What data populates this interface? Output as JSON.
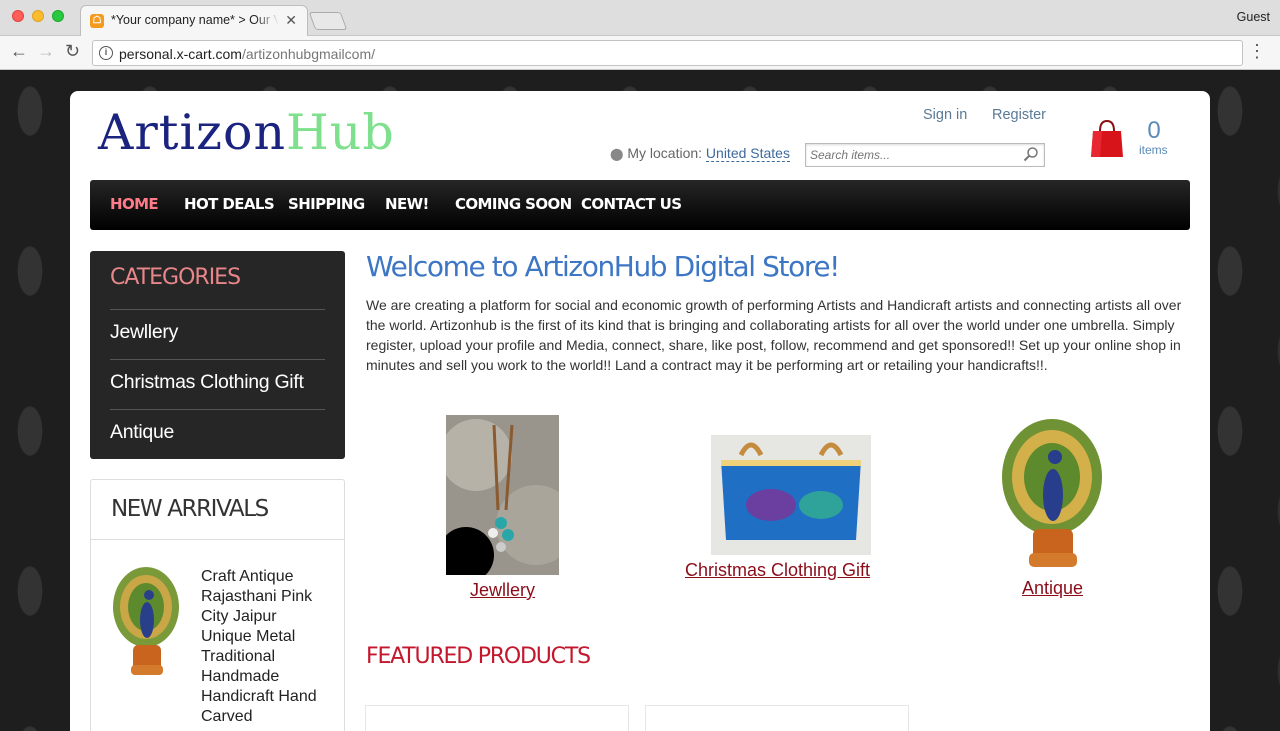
{
  "browser": {
    "tab_title": "*Your company name* > Our V",
    "profile": "Guest",
    "url_host": "personal.x-cart.com",
    "url_path": "/artizonhubgmailcom/"
  },
  "header": {
    "logo_part1": "Artizon",
    "logo_part2": "Hub",
    "signin": "Sign in",
    "register": "Register",
    "location_label": "My location:",
    "location_value": "United States",
    "search_placeholder": "Search items...",
    "cart_count": "0",
    "cart_label": "items"
  },
  "nav": [
    "HOME",
    "HOT DEALS",
    "SHIPPING",
    "NEW!",
    "COMING SOON",
    "CONTACT US"
  ],
  "sidebar": {
    "categories_title": "CATEGORIES",
    "categories": [
      "Jewllery",
      "Christmas Clothing Gift",
      "Antique"
    ],
    "new_arrivals_title": "NEW ARRIVALS",
    "arrival_name": "Craft Antique Rajasthani Pink City Jaipur Unique Metal Traditional Handmade Handicraft Hand Carved"
  },
  "main": {
    "welcome": "Welcome to ArtizonHub Digital Store!",
    "intro": "We are creating a platform for social and economic growth of performing Artists and Handicraft artists and connecting artists all over the world. Artizonhub is the first of its kind that is bringing and collaborating artists for all over the world under one umbrella. Simply register, upload your profile and Media, connect, share, like post, follow, recommend and get sponsored!! Set up your online shop in minutes and sell you work to the world!! Land a contract may it be performing art or retailing your handicrafts!!.",
    "tiles": [
      "Jewllery",
      "Christmas Clothing Gift",
      "Antique"
    ],
    "featured_title": "FEATURED PRODUCTS"
  },
  "colors": {
    "logo_primary": "#1a237e",
    "logo_accent": "#7ee08c",
    "nav_active": "#ff7b8a",
    "welcome": "#3d76c4",
    "featured": "#c4172d",
    "tile_link": "#8b0d1a"
  }
}
